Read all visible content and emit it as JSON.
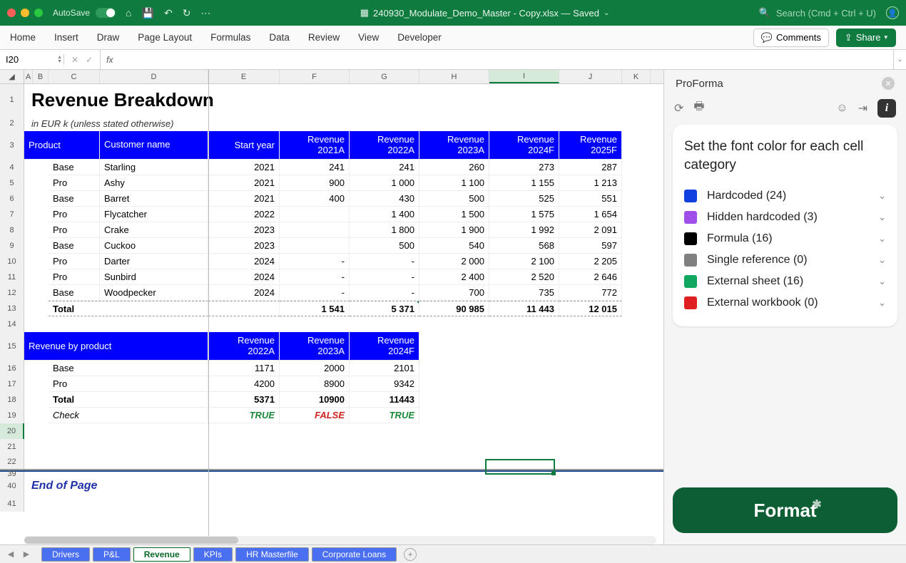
{
  "titlebar": {
    "autosave": "AutoSave",
    "filename": "240930_Modulate_Demo_Master - Copy.xlsx — Saved",
    "search_placeholder": "Search (Cmd + Ctrl + U)"
  },
  "ribbon": {
    "tabs": [
      "Home",
      "Insert",
      "Draw",
      "Page Layout",
      "Formulas",
      "Data",
      "Review",
      "View",
      "Developer"
    ],
    "comments": "Comments",
    "share": "Share"
  },
  "namebox": "I20",
  "fx_label": "fx",
  "columns": [
    "A",
    "B",
    "C",
    "D",
    "E",
    "F",
    "G",
    "H",
    "I",
    "J",
    "K"
  ],
  "sheet": {
    "title": "Revenue Breakdown",
    "subtitle": "in EUR k (unless stated otherwise)",
    "headers1": {
      "product": "Product",
      "customer": "Customer name",
      "start": "Start year",
      "r21": "Revenue 2021A",
      "r22": "Revenue 2022A",
      "r23": "Revenue 2023A",
      "r24": "Revenue 2024F",
      "r25": "Revenue 2025F"
    },
    "rows1": [
      {
        "n": 4,
        "p": "Base",
        "c": "Starling",
        "y": "2021",
        "v": [
          "241",
          "241",
          "260",
          "273",
          "287"
        ]
      },
      {
        "n": 5,
        "p": "Pro",
        "c": "Ashy",
        "y": "2021",
        "v": [
          "900",
          "1 000",
          "1 100",
          "1 155",
          "1 213"
        ]
      },
      {
        "n": 6,
        "p": "Base",
        "c": "Barret",
        "y": "2021",
        "v": [
          "400",
          "430",
          "500",
          "525",
          "551"
        ]
      },
      {
        "n": 7,
        "p": "Pro",
        "c": "Flycatcher",
        "y": "2022",
        "v": [
          "",
          "1 400",
          "1 500",
          "1 575",
          "1 654"
        ]
      },
      {
        "n": 8,
        "p": "Pro",
        "c": "Crake",
        "y": "2023",
        "v": [
          "",
          "1 800",
          "1 900",
          "1 992",
          "2 091"
        ]
      },
      {
        "n": 9,
        "p": "Base",
        "c": "Cuckoo",
        "y": "2023",
        "v": [
          "",
          "500",
          "540",
          "568",
          "597"
        ]
      },
      {
        "n": 10,
        "p": "Pro",
        "c": "Darter",
        "y": "2024",
        "v": [
          "-",
          "-",
          "2 000",
          "2 100",
          "2 205"
        ]
      },
      {
        "n": 11,
        "p": "Pro",
        "c": "Sunbird",
        "y": "2024",
        "v": [
          "-",
          "-",
          "2 400",
          "2 520",
          "2 646"
        ]
      },
      {
        "n": 12,
        "p": "Base",
        "c": "Woodpecker",
        "y": "2024",
        "v": [
          "-",
          "-",
          "700",
          "735",
          "772"
        ]
      }
    ],
    "total1": {
      "label": "Total",
      "v": [
        "1 541",
        "5 371",
        "90 985",
        "11 443",
        "12 015"
      ]
    },
    "headers2": {
      "title": "Revenue by product",
      "r22": "Revenue 2022A",
      "r23": "Revenue 2023A",
      "r24": "Revenue 2024F"
    },
    "rows2": [
      {
        "n": 16,
        "p": "Base",
        "v": [
          "1171",
          "2000",
          "2101"
        ]
      },
      {
        "n": 17,
        "p": "Pro",
        "v": [
          "4200",
          "8900",
          "9342"
        ]
      }
    ],
    "total2": {
      "label": "Total",
      "v": [
        "5371",
        "10900",
        "11443"
      ]
    },
    "check": {
      "label": "Check",
      "v": [
        "TRUE",
        "FALSE",
        "TRUE"
      ],
      "ok": [
        true,
        false,
        true
      ]
    },
    "eop": "End of Page"
  },
  "panel": {
    "title": "ProForma",
    "heading": "Set the font color for each cell category",
    "cats": [
      {
        "color": "#1040e0",
        "label": "Hardcoded (24)"
      },
      {
        "color": "#a050e8",
        "label": "Hidden hardcoded (3)"
      },
      {
        "color": "#000000",
        "label": "Formula (16)"
      },
      {
        "color": "#808080",
        "label": "Single reference (0)"
      },
      {
        "color": "#10a860",
        "label": "External sheet (16)"
      },
      {
        "color": "#e02020",
        "label": "External workbook (0)"
      }
    ],
    "button": "Format"
  },
  "tabs": {
    "items": [
      "Drivers",
      "P&L",
      "Revenue",
      "KPIs",
      "HR Masterfile",
      "Corporate Loans"
    ],
    "active": 2
  }
}
